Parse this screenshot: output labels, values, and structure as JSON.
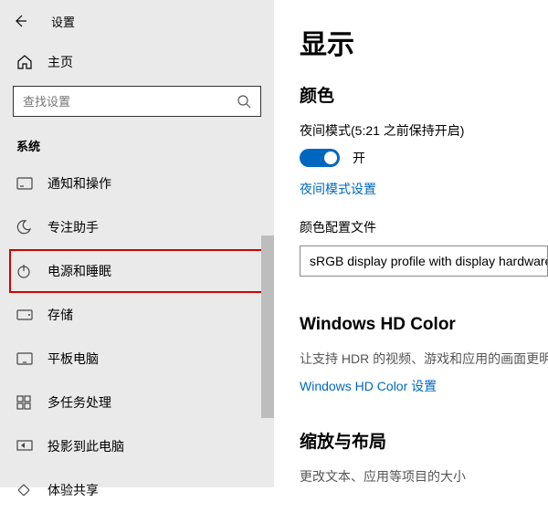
{
  "window": {
    "title": "设置"
  },
  "sidebar": {
    "home_label": "主页",
    "search_placeholder": "查找设置",
    "section_label": "系统",
    "items": [
      {
        "label": "通知和操作"
      },
      {
        "label": "专注助手"
      },
      {
        "label": "电源和睡眠"
      },
      {
        "label": "存储"
      },
      {
        "label": "平板电脑"
      },
      {
        "label": "多任务处理"
      },
      {
        "label": "投影到此电脑"
      },
      {
        "label": "体验共享"
      }
    ]
  },
  "content": {
    "page_title": "显示",
    "section_color": "颜色",
    "night_mode_label": "夜间模式(5:21 之前保持开启)",
    "toggle_state": "开",
    "night_mode_link": "夜间模式设置",
    "profile_label": "颜色配置文件",
    "profile_value": "sRGB display profile with display hardware",
    "hd_color_title": "Windows HD Color",
    "hd_color_desc": "让支持 HDR 的视频、游戏和应用的画面更明",
    "hd_color_link": "Windows HD Color 设置",
    "scale_title": "缩放与布局",
    "scale_desc": "更改文本、应用等项目的大小"
  }
}
